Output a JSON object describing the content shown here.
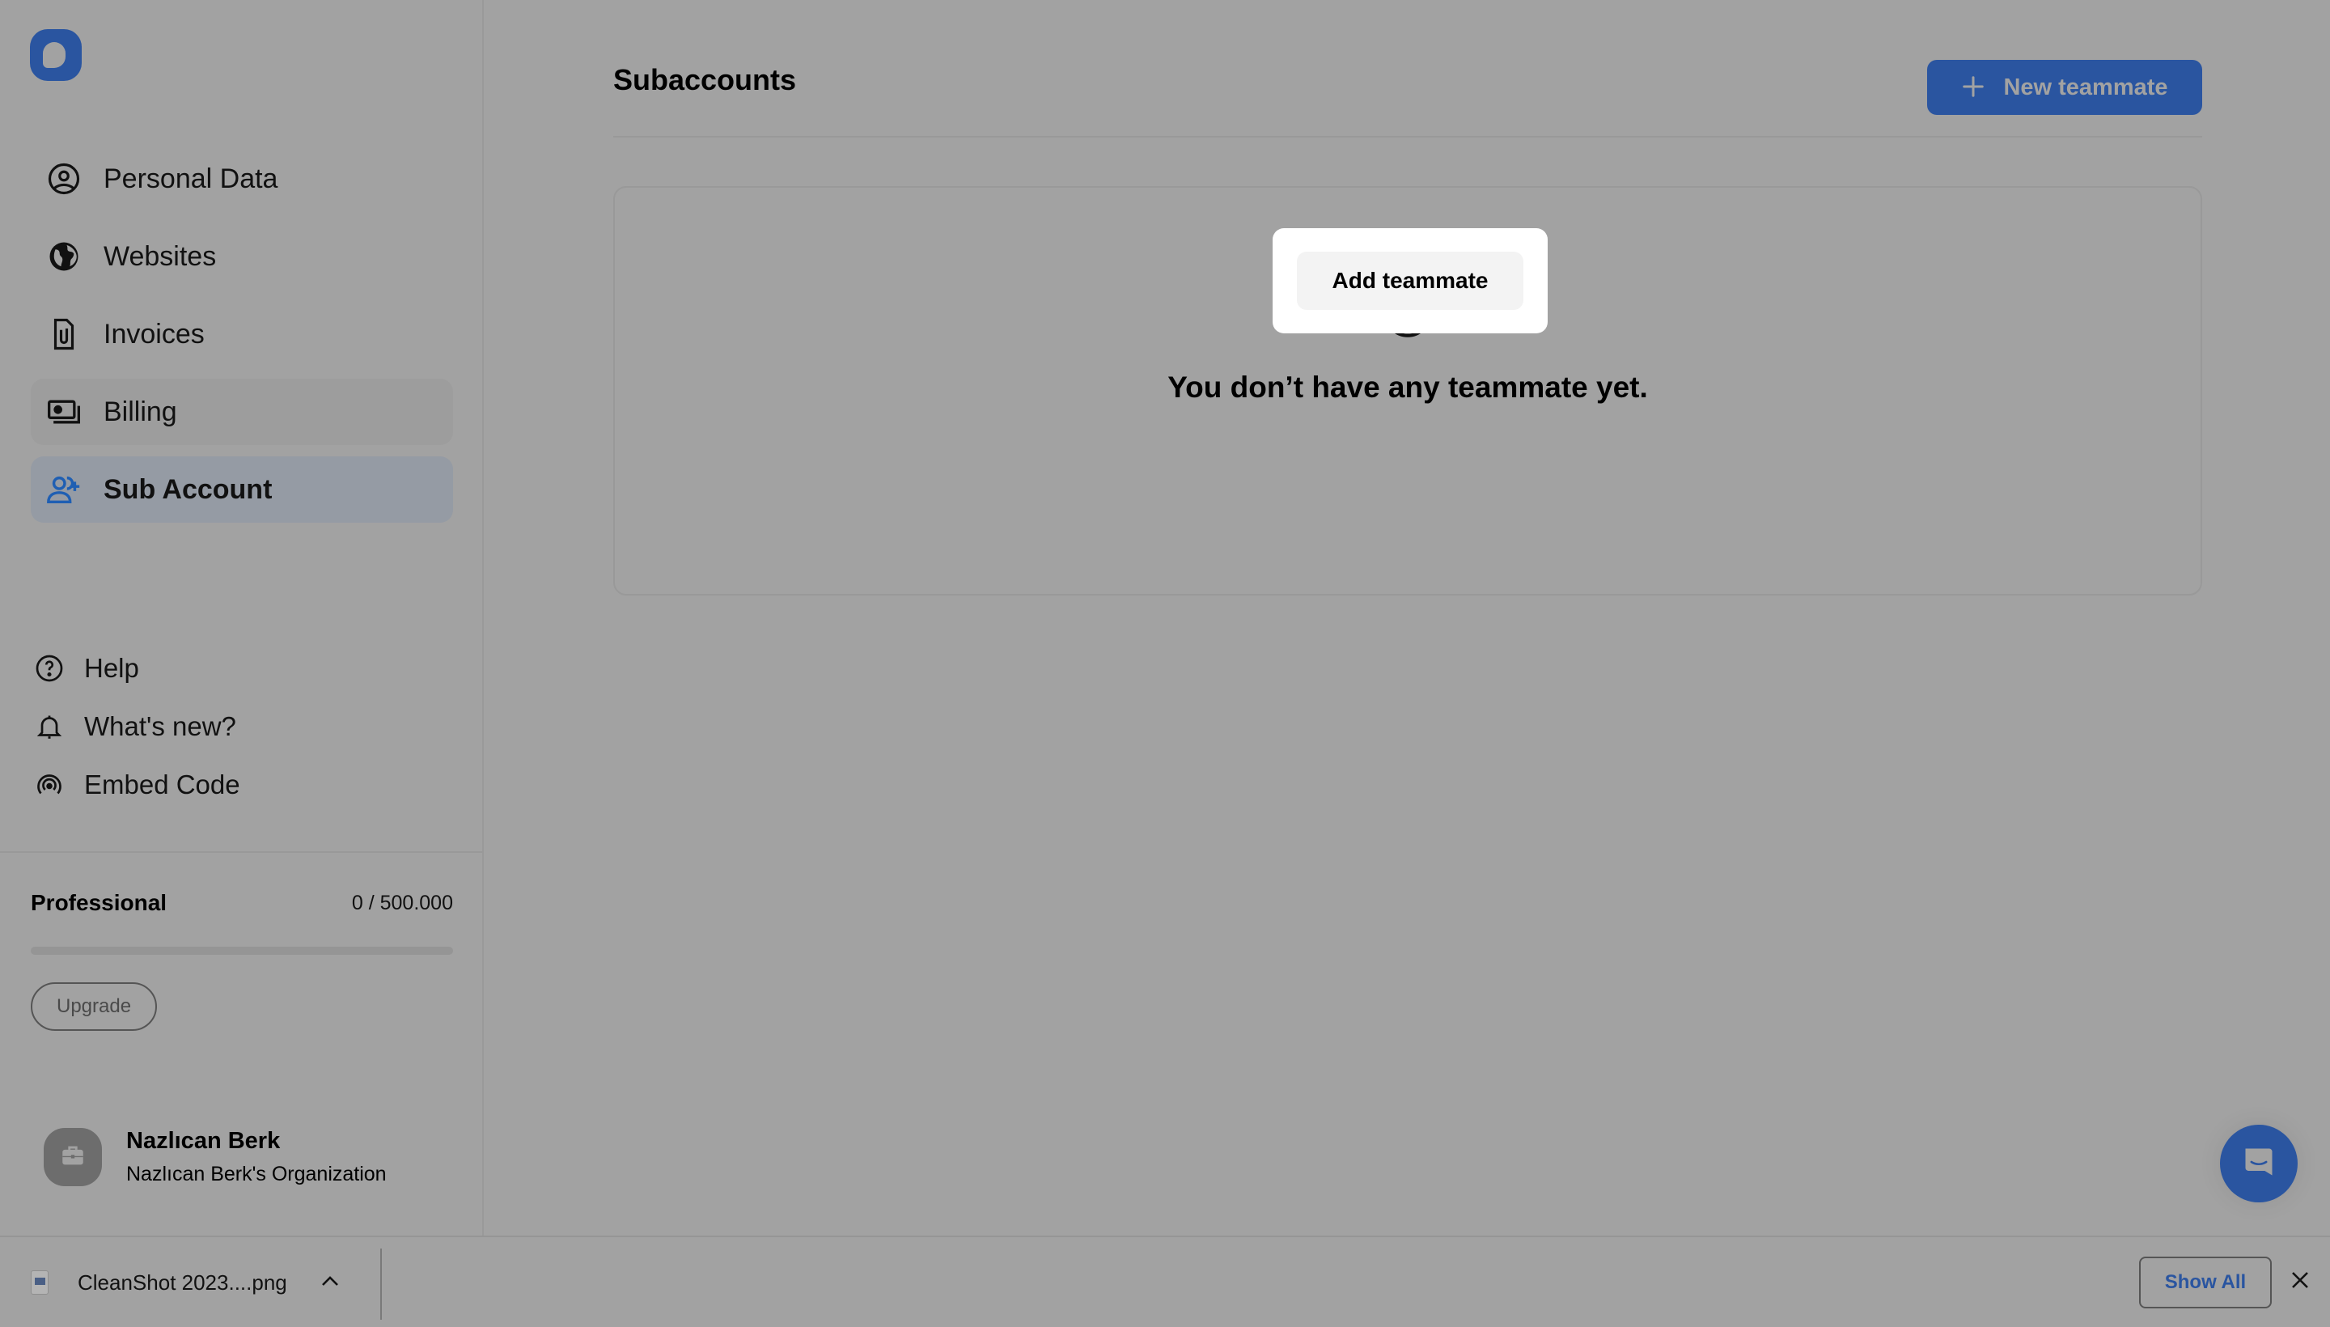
{
  "app": {
    "brand_color": "#2a55a0",
    "overlay_color": "#a2a2a2"
  },
  "sidebar": {
    "logo_icon": "brand-logo",
    "nav_items": [
      {
        "label": "Personal Data",
        "icon": "user-circle-icon",
        "state": "default"
      },
      {
        "label": "Websites",
        "icon": "globe-icon",
        "state": "default"
      },
      {
        "label": "Invoices",
        "icon": "document-attachment-icon",
        "state": "default"
      },
      {
        "label": "Billing",
        "icon": "banknotes-icon",
        "state": "hover"
      },
      {
        "label": "Sub Account",
        "icon": "user-plus-icon",
        "state": "active"
      }
    ],
    "secondary_items": [
      {
        "label": "Help",
        "icon": "question-circle-icon"
      },
      {
        "label": "What's new?",
        "icon": "bell-icon"
      },
      {
        "label": "Embed Code",
        "icon": "broadcast-icon"
      }
    ],
    "plan": {
      "name": "Professional",
      "usage": "0 / 500.000",
      "used": 0,
      "limit": 500000,
      "progress_percent": 0,
      "upgrade_label": "Upgrade"
    },
    "user": {
      "name": "Nazlıcan Berk",
      "organization": "Nazlıcan Berk's Organization",
      "avatar_icon": "briefcase-icon"
    }
  },
  "main": {
    "title": "Subaccounts",
    "new_button_label": "New teammate",
    "empty_state": {
      "icon": "sad-face-icon",
      "message": "You don’t have any teammate yet.",
      "button_label": "Add teammate"
    }
  },
  "chat_widget": {
    "icon": "chat-bubble-icon"
  },
  "download_bar": {
    "file_name": "CleanShot 2023....png",
    "show_all_label": "Show All"
  }
}
